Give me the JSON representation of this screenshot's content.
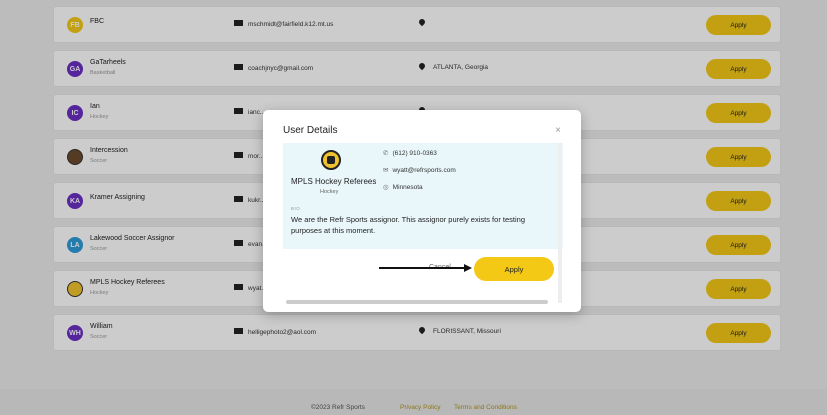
{
  "rows": [
    {
      "initials": "FB",
      "color": "#f3c916",
      "name": "FBC",
      "sport": "",
      "email": "mschmidt@fairfield.k12.mt.us",
      "location": "",
      "apply": "Apply"
    },
    {
      "initials": "GA",
      "color": "#6b2fc4",
      "name": "GaTarheels",
      "sport": "Basketball",
      "email": "coachjnyc@gmail.com",
      "location": "ATLANTA, Georgia",
      "apply": "Apply"
    },
    {
      "initials": "IC",
      "color": "#6b2fc4",
      "name": "Ian",
      "sport": "Hockey",
      "email": "ianc...",
      "location": "",
      "apply": "Apply"
    },
    {
      "initials": "",
      "color": "#6b4a2e",
      "name": "Intercession",
      "sport": "Soccer",
      "email": "mor...",
      "location": "",
      "apply": "Apply"
    },
    {
      "initials": "KA",
      "color": "#6b2fc4",
      "name": "Kramer Assigning",
      "sport": "",
      "email": "kukr...",
      "location": "",
      "apply": "Apply"
    },
    {
      "initials": "LA",
      "color": "#2d9bd9",
      "name": "Lakewood Soccer Assignor",
      "sport": "Soccer",
      "email": "evan...",
      "location": "",
      "apply": "Apply"
    },
    {
      "initials": "",
      "color": "#f1c230",
      "name": "MPLS Hockey Referees",
      "sport": "Hockey",
      "email": "wyat...",
      "location": "",
      "apply": "Apply"
    },
    {
      "initials": "WH",
      "color": "#6b2fc4",
      "name": "William",
      "sport": "Soccer",
      "email": "helligephoto2@aol.com",
      "location": "FLORISSANT, Missouri",
      "apply": "Apply"
    }
  ],
  "footer": {
    "copyright": "©2023 Refr Sports",
    "privacy": "Privacy Policy",
    "terms": "Terms and Conditions"
  },
  "modal": {
    "title": "User Details",
    "close": "×",
    "name": "MPLS Hockey Referees",
    "sport": "Hockey",
    "phone": "(612) 910-0363",
    "email": "wyatt@refrsports.com",
    "location": "Minnesota",
    "bio_label": "BIO",
    "bio": "We are the Refr Sports assignor. This assignor purely exists for testing purposes at this moment.",
    "cancel": "Cancel",
    "apply": "Apply"
  }
}
